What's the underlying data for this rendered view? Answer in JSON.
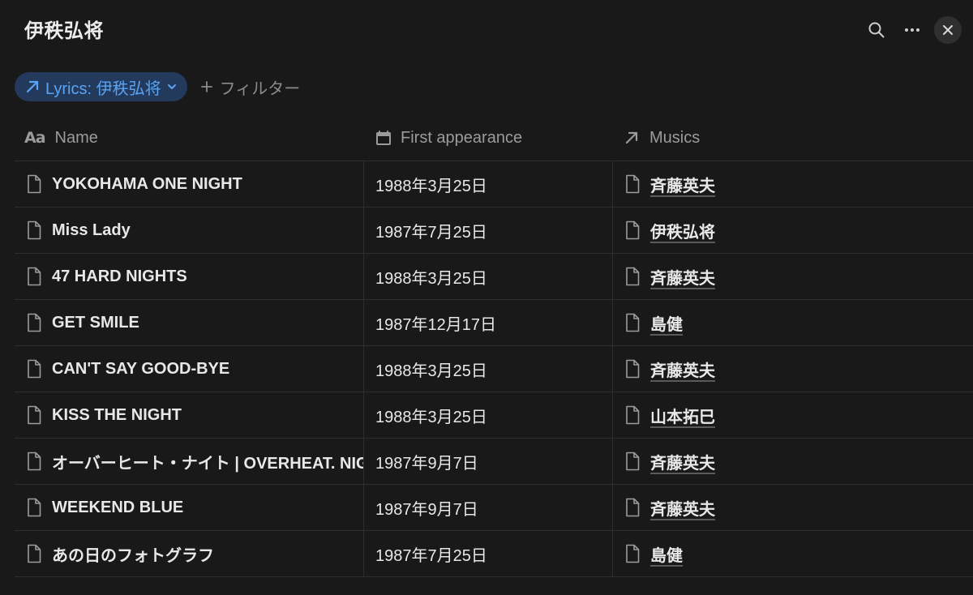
{
  "page": {
    "title": "伊秩弘将"
  },
  "filter": {
    "chip_label": "Lyrics: 伊秩弘将",
    "add_label": "フィルター"
  },
  "columns": {
    "name": "Name",
    "first_appearance": "First appearance",
    "musics": "Musics",
    "name_icon_text": "Aa"
  },
  "rows": [
    {
      "name": "YOKOHAMA ONE NIGHT",
      "date": "1988年3月25日",
      "music": "斉藤英夫"
    },
    {
      "name": "Miss Lady",
      "date": "1987年7月25日",
      "music": "伊秩弘将"
    },
    {
      "name": "47 HARD NIGHTS",
      "date": "1988年3月25日",
      "music": "斉藤英夫"
    },
    {
      "name": "GET SMILE",
      "date": "1987年12月17日",
      "music": "島健"
    },
    {
      "name": "CAN'T SAY GOOD-BYE",
      "date": "1988年3月25日",
      "music": "斉藤英夫"
    },
    {
      "name": "KISS THE NIGHT",
      "date": "1988年3月25日",
      "music": "山本拓巳"
    },
    {
      "name": "オーバーヒート・ナイト | OVERHEAT. NIGHT",
      "date": "1987年9月7日",
      "music": "斉藤英夫"
    },
    {
      "name": "WEEKEND BLUE",
      "date": "1987年9月7日",
      "music": "斉藤英夫"
    },
    {
      "name": "あの日のフォトグラフ",
      "date": "1987年7月25日",
      "music": "島健"
    }
  ],
  "icons": {
    "search": "search-icon",
    "more": "more-icon",
    "close": "close-icon",
    "relation": "arrow-up-right-icon",
    "chevron": "chevron-down-icon",
    "plus": "plus-icon",
    "calendar": "calendar-icon",
    "page": "page-icon"
  },
  "colors": {
    "background": "#191919",
    "chip_bg": "#233a5c",
    "accent": "#5aa4f5"
  }
}
